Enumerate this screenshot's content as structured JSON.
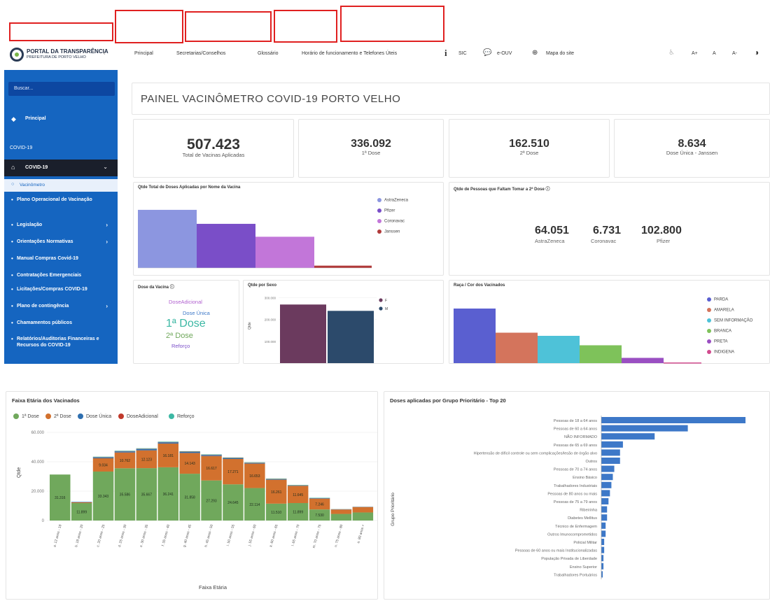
{
  "header": {
    "logo_title": "PORTAL DA TRANSPARÊNCIA",
    "logo_subtitle": "PREFEITURA DE PORTO VELHO",
    "collapse_glyph": "‹",
    "nav": [
      "Principal",
      "Secretarias/Conselhos",
      "Glossário",
      "Horário de funcionamento e Telefones Úteis"
    ],
    "info_glyph": "i",
    "sic_label": "SIC",
    "eouv_label": "e-OUV",
    "sitemap_label": "Mapa do site",
    "font_controls": [
      "A+",
      "A",
      "A-"
    ]
  },
  "sidebar": {
    "search_placeholder": "Buscar...",
    "principal": "Principal",
    "section": "COVID-19",
    "active": "COVID-19",
    "sub": "Vacinômetro",
    "items": [
      {
        "label": "Plano Operacional de Vacinação",
        "arrow": false
      },
      {
        "label": "Legislação",
        "arrow": true
      },
      {
        "label": "Orientações Normativas",
        "arrow": true
      },
      {
        "label": "Manual Compras Covid-19",
        "arrow": false
      },
      {
        "label": "Contratações Emergenciais",
        "arrow": false
      },
      {
        "label": "Licitações/Compras COVID-19",
        "arrow": false
      },
      {
        "label": "Plano de contingência",
        "arrow": true
      },
      {
        "label": "Chamamentos públicos",
        "arrow": false
      },
      {
        "label": "Relatórios/Auditorias Financeiras e Recursos do COVID-19",
        "arrow": false
      }
    ]
  },
  "panel": {
    "title": "PAINEL VACINÔMETRO COVID-19 PORTO VELHO",
    "kpis": [
      {
        "value": "507.423",
        "label": "Total de Vacinas Aplicadas"
      },
      {
        "value": "336.092",
        "label": "1ª Dose"
      },
      {
        "value": "162.510",
        "label": "2ª Dose"
      },
      {
        "value": "8.634",
        "label": "Dose Única - Janssen"
      }
    ],
    "vaccine_chart": {
      "title": "Qtde Total de Doses Aplicadas por Nome da Vacina",
      "legend": [
        "AstraZeneca",
        "Pfizer",
        "Coronavac",
        "Janssen"
      ]
    },
    "second_dose": {
      "title": "Qtde de Pessoas que Faltam Tomar a 2ª Dose ⓘ",
      "items": [
        {
          "value": "64.051",
          "label": "AstraZeneca"
        },
        {
          "value": "6.731",
          "label": "Coronavac"
        },
        {
          "value": "102.800",
          "label": "Pfizer"
        }
      ]
    },
    "dose_cloud": {
      "title": "Dose da Vacina ⓘ",
      "words": [
        "DoseAdicional",
        "Dose Única",
        "1ª Dose",
        "2ª Dose",
        "Reforço"
      ]
    },
    "sex_chart": {
      "title": "Qtde por Sexo",
      "legend": [
        "F",
        "M"
      ],
      "ylabel": "Qtde"
    },
    "race_chart": {
      "title": "Raça / Cor dos Vacinados",
      "legend": [
        "PARDA",
        "AMARELA",
        "SEM INFORMAÇÃO",
        "BRANCA",
        "PRETA",
        "INDIGENA"
      ]
    }
  },
  "colors": {
    "sidebar": "#1565c0",
    "astrazeneca": "#8c96e0",
    "pfizer": "#7a4ec8",
    "coronavac": "#c276d9",
    "janssen": "#b03a3a",
    "dose1": "#70a85c",
    "dose2": "#d2712e",
    "dose_unica": "#2f6fb0",
    "dose_adicional": "#c0392b",
    "reforco": "#3cb8a4",
    "groups_bar": "#3d78c8"
  },
  "chart_data": [
    {
      "type": "bar",
      "title": "Qtde Total de Doses Aplicadas por Nome da Vacina",
      "series": [
        {
          "name": "AstraZeneca",
          "values": [
            216000
          ]
        },
        {
          "name": "Pfizer",
          "values": [
            164000
          ]
        },
        {
          "name": "Coronavac",
          "values": [
            116000
          ]
        },
        {
          "name": "Janssen",
          "values": [
            8634
          ]
        }
      ],
      "ylim": [
        0,
        260000
      ]
    },
    {
      "type": "bar",
      "title": "Qtde por Sexo",
      "ylabel": "Qtde",
      "categories": [
        "F",
        "M"
      ],
      "values": [
        268000,
        239000
      ],
      "yticks": [
        "300.000",
        "200.000",
        "100.000"
      ],
      "ylim": [
        0,
        320000
      ]
    },
    {
      "type": "bar",
      "title": "Raça / Cor dos Vacinados",
      "categories": [
        "PARDA",
        "AMARELA",
        "SEM INFORMAÇÃO",
        "BRANCA",
        "PRETA",
        "INDIGENA"
      ],
      "values": [
        260000,
        145000,
        130000,
        85000,
        25000,
        3000
      ],
      "ylim": [
        0,
        300000
      ]
    },
    {
      "type": "bar",
      "title": "Faixa Etária dos Vacinados",
      "xlabel": "Faixa Etária",
      "ylabel": "Qtde",
      "legend_placement": "top-left",
      "yticks": [
        "60.000",
        "40.000",
        "20.000",
        "0"
      ],
      "ylim": [
        0,
        60000
      ],
      "categories": [
        "a. 12 anos - 19",
        "b. 18 anos - 20",
        "c. 20 anos - 25",
        "d. 25 anos - 30",
        "e. 30 anos - 35",
        "f. 35 anos - 40",
        "g. 40 anos - 45",
        "h. 45 anos - 50",
        "i. 50 anos - 55",
        "j. 55 anos - 60",
        "k. 60 anos - 65",
        "l. 65 anos - 70",
        "m. 70 anos - 75",
        "n. 75 anos - 80",
        "o. 80 anos +"
      ],
      "series": [
        {
          "name": "1ª Dose",
          "values": [
            31316,
            11899,
            33343,
            35586,
            35667,
            36241,
            31858,
            27293,
            24645,
            22114,
            11510,
            11899,
            7530,
            4500,
            5500
          ],
          "labels": [
            "31.316",
            "11.899",
            "33.343",
            "35.586",
            "35.667",
            "36.241",
            "31.858",
            "27.293",
            "24.645",
            "22.114",
            "11.510",
            "11.899",
            "7.530",
            "",
            ""
          ]
        },
        {
          "name": "2ª Dose",
          "values": [
            0,
            500,
            9034,
            10762,
            12123,
            16181,
            14143,
            16617,
            17271,
            16653,
            16261,
            11645,
            7246,
            3000,
            3600
          ],
          "labels": [
            "",
            "",
            "9.034",
            "10.762",
            "12.123",
            "16.181",
            "14.143",
            "16.617",
            "17.271",
            "16.653",
            "16.261",
            "11.645",
            "7.246",
            "",
            ""
          ]
        },
        {
          "name": "Dose Única",
          "values": [
            0,
            300,
            600,
            700,
            900,
            800,
            700,
            600,
            500,
            400,
            300,
            200,
            200,
            100,
            100
          ]
        },
        {
          "name": "DoseAdicional",
          "values": [
            0,
            0,
            200,
            200,
            200,
            200,
            200,
            200,
            200,
            200,
            200,
            200,
            200,
            100,
            100
          ]
        },
        {
          "name": "Reforço",
          "values": [
            0,
            0,
            300,
            300,
            300,
            300,
            300,
            300,
            300,
            300,
            300,
            300,
            300,
            100,
            100
          ]
        }
      ]
    },
    {
      "type": "bar",
      "orientation": "horizontal",
      "title": "Doses aplicadas por Grupo Prioritário - Top 20",
      "ylabel": "Grupo Prioritário",
      "categories": [
        "Pessoas de 18 a 64 anos",
        "Pessoas de 60 a 64 anos",
        "NÃO INFORMADO",
        "Pessoas de 65 a 69 anos",
        "Hipertensão de difícil controle ou sem complicações/lesão de órgão alvo",
        "Outros",
        "Pessoas de 70 a 74 anos",
        "Ensino Básico",
        "Trabalhadores Industriais",
        "Pessoas de 80 anos ou mais",
        "Pessoas de 75 a 79 anos",
        "Ribeirinha",
        "Diabetes Mellitus",
        "Técnico de Enfermagem",
        "Outros Imunocomprometidos",
        "Policial Militar",
        "Pessoas de 60 anos ou mais Institucionalizadas",
        "População Privada de Liberdade",
        "Ensino Superior",
        "Trabalhadores Portuários"
      ],
      "values": [
        100,
        60,
        37,
        15,
        13,
        13,
        9,
        8,
        7,
        6,
        5,
        4,
        4,
        3,
        3,
        2,
        2,
        1.5,
        1.5,
        1
      ]
    }
  ],
  "charts_bottom": {
    "faixa_title": "Faixa Etária dos Vacinados",
    "faixa_xlabel": "Faixa Etária",
    "faixa_ylabel": "Qtde",
    "faixa_legend": [
      "1ª Dose",
      "2ª Dose",
      "Dose Única",
      "DoseAdicional",
      "Reforço"
    ],
    "grupos_title": "Doses aplicadas por Grupo Prioritário - Top 20",
    "grupos_ylabel": "Grupo Prioritário"
  }
}
